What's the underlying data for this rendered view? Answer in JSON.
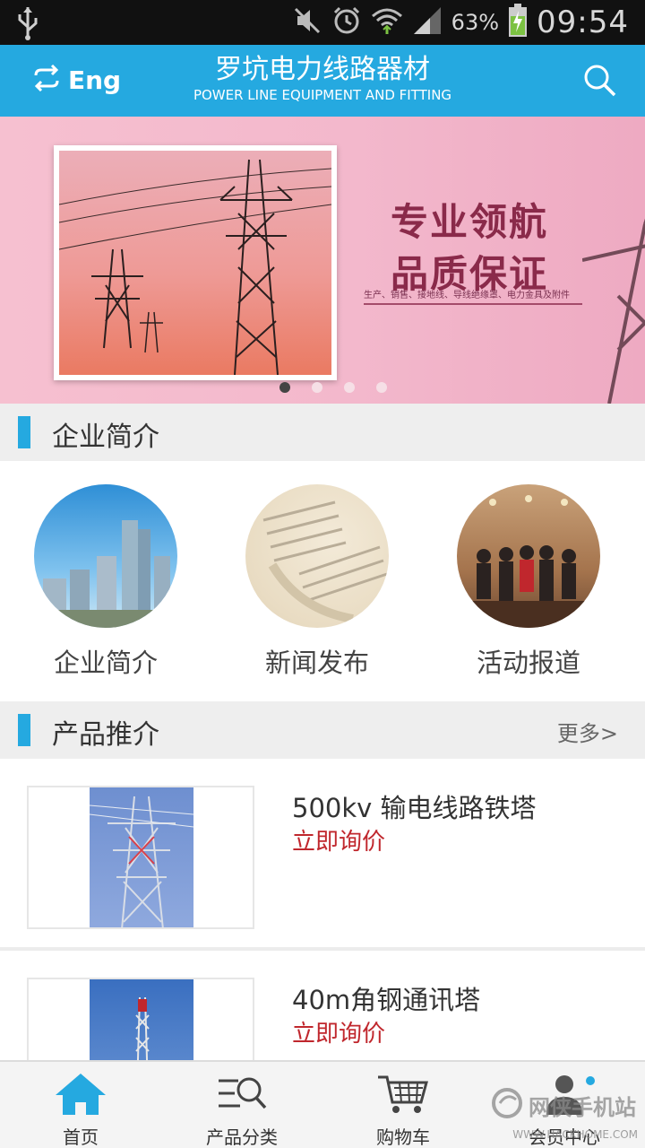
{
  "status_bar": {
    "battery_percent": "63%",
    "time": "09:54",
    "icons": [
      "usb-icon",
      "mute-icon",
      "alarm-icon",
      "wifi-icon",
      "signal-icon",
      "battery-charging-icon"
    ]
  },
  "header": {
    "lang_label": "Eng",
    "title_cn": "罗坑电力线路器材",
    "title_en": "POWER LINE EQUIPMENT AND FITTING",
    "accent_color": "#25a9e0"
  },
  "banner": {
    "slogan_line1": "专业领航",
    "slogan_line2": "品质保证",
    "slogan_sub": "生产、销售、接地线、导线绝缘罩、电力金具及附件",
    "dots_total": 4,
    "active_dot": 1
  },
  "section_intro": {
    "title": "企业简介",
    "items": [
      {
        "label": "企业简介",
        "icon": "city-buildings-image"
      },
      {
        "label": "新闻发布",
        "icon": "newspaper-image"
      },
      {
        "label": "活动报道",
        "icon": "event-people-image"
      }
    ]
  },
  "section_products": {
    "title": "产品推介",
    "more_label": "更多>",
    "products": [
      {
        "name": "500kv 输电线路铁塔",
        "action": "立即询价"
      },
      {
        "name": "40m角钢通讯塔",
        "action": "立即询价"
      }
    ]
  },
  "bottom_nav": {
    "items": [
      {
        "label": "首页",
        "icon": "home-icon"
      },
      {
        "label": "产品分类",
        "icon": "category-search-icon"
      },
      {
        "label": "购物车",
        "icon": "cart-icon"
      },
      {
        "label": "会员中心",
        "icon": "member-icon"
      }
    ]
  },
  "watermark": {
    "text": "网侠手机站",
    "sub": "WWW.HACKHOME.COM"
  }
}
